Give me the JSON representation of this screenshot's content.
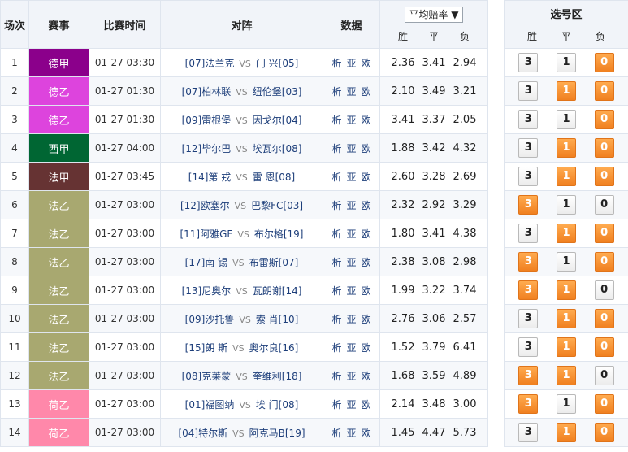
{
  "headers": {
    "idx": "场次",
    "comp": "赛事",
    "time": "比赛时间",
    "match": "对阵",
    "data": "数据",
    "odds_select": "平均赔率",
    "odds_win": "胜",
    "odds_draw": "平",
    "odds_lose": "负",
    "select_title": "选号区",
    "sel_win": "胜",
    "sel_draw": "平",
    "sel_lose": "负"
  },
  "data_links": [
    "析",
    "亚",
    "欧"
  ],
  "vs": "VS",
  "colors": {
    "active": "#f08020"
  },
  "rows": [
    {
      "idx": "1",
      "comp": "德甲",
      "color": "#8b008b",
      "time": "01-27 03:30",
      "hr": "[07]",
      "home": "法兰克",
      "away": "门 兴",
      "ar": "[05]",
      "o": [
        "2.36",
        "3.41",
        "2.94"
      ],
      "sel": [
        false,
        false,
        true
      ]
    },
    {
      "idx": "2",
      "comp": "德乙",
      "color": "#dd44dd",
      "time": "01-27 01:30",
      "hr": "[07]",
      "home": "柏林联",
      "away": "纽伦堡",
      "ar": "[03]",
      "o": [
        "2.10",
        "3.49",
        "3.21"
      ],
      "sel": [
        false,
        true,
        true
      ]
    },
    {
      "idx": "3",
      "comp": "德乙",
      "color": "#dd44dd",
      "time": "01-27 01:30",
      "hr": "[09]",
      "home": "雷根堡",
      "away": "因戈尔",
      "ar": "[04]",
      "o": [
        "3.41",
        "3.37",
        "2.05"
      ],
      "sel": [
        false,
        false,
        true
      ]
    },
    {
      "idx": "4",
      "comp": "西甲",
      "color": "#006633",
      "time": "01-27 04:00",
      "hr": "[12]",
      "home": "毕尔巴",
      "away": "埃瓦尔",
      "ar": "[08]",
      "o": [
        "1.88",
        "3.42",
        "4.32"
      ],
      "sel": [
        false,
        true,
        true
      ]
    },
    {
      "idx": "5",
      "comp": "法甲",
      "color": "#663333",
      "time": "01-27 03:45",
      "hr": "[14]",
      "home": "第 戎",
      "away": "雷 恩",
      "ar": "[08]",
      "o": [
        "2.60",
        "3.28",
        "2.69"
      ],
      "sel": [
        false,
        true,
        true
      ]
    },
    {
      "idx": "6",
      "comp": "法乙",
      "color": "#a8a870",
      "time": "01-27 03:00",
      "hr": "[12]",
      "home": "欧塞尔",
      "away": "巴黎FC",
      "ar": "[03]",
      "o": [
        "2.32",
        "2.92",
        "3.29"
      ],
      "sel": [
        true,
        false,
        false
      ]
    },
    {
      "idx": "7",
      "comp": "法乙",
      "color": "#a8a870",
      "time": "01-27 03:00",
      "hr": "[11]",
      "home": "阿雅GF",
      "away": "布尔格",
      "ar": "[19]",
      "o": [
        "1.80",
        "3.41",
        "4.38"
      ],
      "sel": [
        false,
        true,
        true
      ]
    },
    {
      "idx": "8",
      "comp": "法乙",
      "color": "#a8a870",
      "time": "01-27 03:00",
      "hr": "[17]",
      "home": "南 锡",
      "away": "布雷斯",
      "ar": "[07]",
      "o": [
        "2.38",
        "3.08",
        "2.98"
      ],
      "sel": [
        true,
        false,
        true
      ]
    },
    {
      "idx": "9",
      "comp": "法乙",
      "color": "#a8a870",
      "time": "01-27 03:00",
      "hr": "[13]",
      "home": "尼奥尔",
      "away": "瓦朗谢",
      "ar": "[14]",
      "o": [
        "1.99",
        "3.22",
        "3.74"
      ],
      "sel": [
        true,
        true,
        false
      ]
    },
    {
      "idx": "10",
      "comp": "法乙",
      "color": "#a8a870",
      "time": "01-27 03:00",
      "hr": "[09]",
      "home": "沙托鲁",
      "away": "索 肖",
      "ar": "[10]",
      "o": [
        "2.76",
        "3.06",
        "2.57"
      ],
      "sel": [
        false,
        true,
        true
      ]
    },
    {
      "idx": "11",
      "comp": "法乙",
      "color": "#a8a870",
      "time": "01-27 03:00",
      "hr": "[15]",
      "home": "朗 斯",
      "away": "奥尔良",
      "ar": "[16]",
      "o": [
        "1.52",
        "3.79",
        "6.41"
      ],
      "sel": [
        false,
        true,
        true
      ]
    },
    {
      "idx": "12",
      "comp": "法乙",
      "color": "#a8a870",
      "time": "01-27 03:00",
      "hr": "[08]",
      "home": "克莱蒙",
      "away": "奎维利",
      "ar": "[18]",
      "o": [
        "1.68",
        "3.59",
        "4.89"
      ],
      "sel": [
        true,
        true,
        false
      ]
    },
    {
      "idx": "13",
      "comp": "荷乙",
      "color": "#ff88aa",
      "time": "01-27 03:00",
      "hr": "[01]",
      "home": "福图纳",
      "away": "埃 门",
      "ar": "[08]",
      "o": [
        "2.14",
        "3.48",
        "3.00"
      ],
      "sel": [
        true,
        false,
        true
      ]
    },
    {
      "idx": "14",
      "comp": "荷乙",
      "color": "#ff88aa",
      "time": "01-27 03:00",
      "hr": "[04]",
      "home": "特尔斯",
      "away": "阿克马B",
      "ar": "[19]",
      "o": [
        "1.45",
        "4.47",
        "5.73"
      ],
      "sel": [
        false,
        true,
        true
      ]
    }
  ]
}
